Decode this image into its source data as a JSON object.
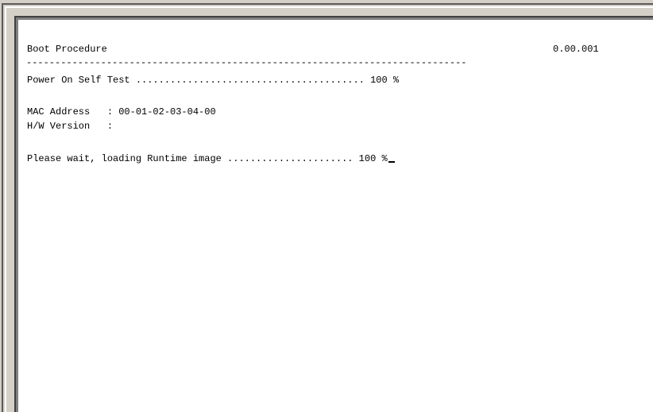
{
  "terminal": {
    "title": "Boot Procedure",
    "version": "0.00.001",
    "separator": "-----------------------------------------------------------------------------",
    "post_line": "Power On Self Test ........................................ 100 %",
    "mac_line": "MAC Address   : 00-01-02-03-04-00",
    "hw_line": "H/W Version   :",
    "loading_line": "Please wait, loading Runtime image ...................... 100 %"
  }
}
